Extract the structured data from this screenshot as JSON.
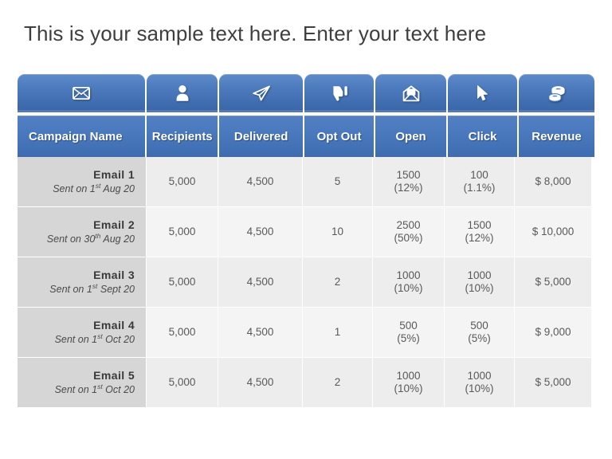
{
  "slide": {
    "title": "This is your sample text here. Enter your text here",
    "accent_color": "#4574bc",
    "header_text_color": "#ffffff",
    "name_column_bg": "#d6d6d6",
    "row_bg": "#efefef"
  },
  "icon_tabs": [
    {
      "name": "envelope-icon",
      "label": "Campaign"
    },
    {
      "name": "person-icon",
      "label": "Recipients"
    },
    {
      "name": "paper-plane-icon",
      "label": "Delivered"
    },
    {
      "name": "thumbs-down-icon",
      "label": "Opt Out"
    },
    {
      "name": "open-envelope-icon",
      "label": "Open"
    },
    {
      "name": "cursor-arrow-icon",
      "label": "Click"
    },
    {
      "name": "money-stack-icon",
      "label": "Revenue"
    }
  ],
  "table": {
    "columns": [
      "Campaign Name",
      "Recipients",
      "Delivered",
      "Opt Out",
      "Open",
      "Click",
      "Revenue"
    ],
    "rows": [
      {
        "campaign": "Email  1",
        "sent_prefix": "Sent on 1",
        "sent_ordinal": "st",
        "sent_suffix": "  Aug 20",
        "recipients": "5,000",
        "delivered": "4,500",
        "opt_out": "5",
        "open_count": "1500",
        "open_pct": "(12%)",
        "click_count": "100",
        "click_pct": "(1.1%)",
        "revenue": "$ 8,000"
      },
      {
        "campaign": "Email  2",
        "sent_prefix": "Sent on 30",
        "sent_ordinal": "th",
        "sent_suffix": " Aug 20",
        "recipients": "5,000",
        "delivered": "4,500",
        "opt_out": "10",
        "open_count": "2500",
        "open_pct": "(50%)",
        "click_count": "1500",
        "click_pct": "(12%)",
        "revenue": "$ 10,000"
      },
      {
        "campaign": "Email  3",
        "sent_prefix": "Sent on 1",
        "sent_ordinal": "st",
        "sent_suffix": "  Sept 20",
        "recipients": "5,000",
        "delivered": "4,500",
        "opt_out": "2",
        "open_count": "1000",
        "open_pct": "(10%)",
        "click_count": "1000",
        "click_pct": "(10%)",
        "revenue": "$ 5,000"
      },
      {
        "campaign": "Email  4",
        "sent_prefix": "Sent on 1",
        "sent_ordinal": "st",
        "sent_suffix": "  Oct 20",
        "recipients": "5,000",
        "delivered": "4,500",
        "opt_out": "1",
        "open_count": "500",
        "open_pct": "(5%)",
        "click_count": "500",
        "click_pct": "(5%)",
        "revenue": "$ 9,000"
      },
      {
        "campaign": "Email  5",
        "sent_prefix": "Sent on 1",
        "sent_ordinal": "st",
        "sent_suffix": "  Oct 20",
        "recipients": "5,000",
        "delivered": "4,500",
        "opt_out": "2",
        "open_count": "1000",
        "open_pct": "(10%)",
        "click_count": "1000",
        "click_pct": "(10%)",
        "revenue": "$ 5,000"
      }
    ]
  }
}
